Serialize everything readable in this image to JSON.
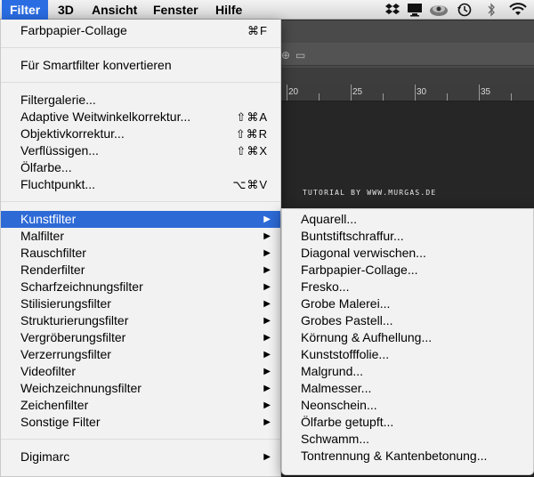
{
  "menubar": {
    "items": [
      {
        "label": "Filter",
        "active": true
      },
      {
        "label": "3D"
      },
      {
        "label": "Ansicht"
      },
      {
        "label": "Fenster"
      },
      {
        "label": "Hilfe"
      }
    ],
    "tray_icons": [
      "dropbox-icon",
      "display-icon",
      "camera-icon",
      "time-machine-icon",
      "bluetooth-icon",
      "wifi-icon"
    ]
  },
  "photoshop": {
    "ruler": [
      "20",
      "25",
      "30",
      "35"
    ],
    "watermark": "TUTORIAL BY WWW.MURGAS.DE"
  },
  "filter_menu": {
    "groups": [
      [
        {
          "label": "Farbpapier-Collage",
          "shortcut": "⌘F"
        }
      ],
      [
        {
          "label": "Für Smartfilter konvertieren"
        }
      ],
      [
        {
          "label": "Filtergalerie..."
        },
        {
          "label": "Adaptive Weitwinkelkorrektur...",
          "shortcut": "⇧⌘A"
        },
        {
          "label": "Objektivkorrektur...",
          "shortcut": "⇧⌘R"
        },
        {
          "label": "Verflüssigen...",
          "shortcut": "⇧⌘X"
        },
        {
          "label": "Ölfarbe..."
        },
        {
          "label": "Fluchtpunkt...",
          "shortcut": "⌥⌘V"
        }
      ],
      [
        {
          "label": "Kunstfilter",
          "submenu": true,
          "highlight": true
        },
        {
          "label": "Malfilter",
          "submenu": true
        },
        {
          "label": "Rauschfilter",
          "submenu": true
        },
        {
          "label": "Renderfilter",
          "submenu": true
        },
        {
          "label": "Scharfzeichnungsfilter",
          "submenu": true
        },
        {
          "label": "Stilisierungsfilter",
          "submenu": true
        },
        {
          "label": "Strukturierungsfilter",
          "submenu": true
        },
        {
          "label": "Vergröberungsfilter",
          "submenu": true
        },
        {
          "label": "Verzerrungsfilter",
          "submenu": true
        },
        {
          "label": "Videofilter",
          "submenu": true
        },
        {
          "label": "Weichzeichnungsfilter",
          "submenu": true
        },
        {
          "label": "Zeichenfilter",
          "submenu": true
        },
        {
          "label": "Sonstige Filter",
          "submenu": true
        }
      ],
      [
        {
          "label": "Digimarc",
          "submenu": true
        }
      ]
    ],
    "arrow_glyph": "▶"
  },
  "submenu": {
    "items": [
      "Aquarell...",
      "Buntstiftschraffur...",
      "Diagonal verwischen...",
      "Farbpapier-Collage...",
      "Fresko...",
      "Grobe Malerei...",
      "Grobes Pastell...",
      "Körnung & Aufhellung...",
      "Kunststofffolie...",
      "Malgrund...",
      "Malmesser...",
      "Neonschein...",
      "Ölfarbe getupft...",
      "Schwamm...",
      "Tontrennung & Kantenbetonung..."
    ]
  }
}
